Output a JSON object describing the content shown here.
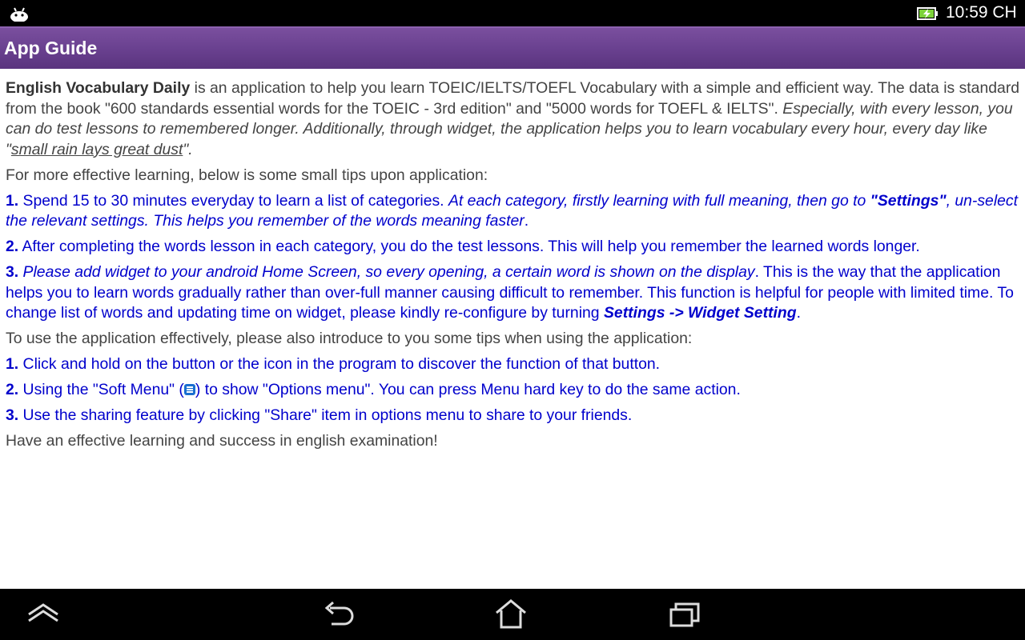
{
  "status_bar": {
    "time": "10:59 CH"
  },
  "action_bar": {
    "title": "App Guide"
  },
  "guide": {
    "intro": {
      "app_name": "English Vocabulary Daily",
      "rest": " is an application to help you learn TOEIC/IELTS/TOEFL Vocabulary with a simple and efficient way. The data is standard from the book \"600 standards essential words for the TOEIC - 3rd edition\" and \"5000 words for TOEFL & IELTS\". ",
      "italic": "Especially, with every lesson, you can do test lessons to remembered longer. Additionally, through widget, the application helps you to learn vocabulary every hour, every day like \"",
      "underlined": "small rain lays great dust",
      "italic_end": "\"."
    },
    "tips_heading": "For more effective learning, below is some small tips upon application:",
    "tip1": {
      "num": "1.",
      "text": " Spend 15 to 30 minutes everyday to learn a list of categories. ",
      "italic": "At each category, firstly learning with full meaning, then go to ",
      "bold_italic": "\"Settings\"",
      "italic2": ", un-select the relevant settings. This helps you remember of the words meaning faster",
      "end": "."
    },
    "tip2": {
      "num": "2.",
      "text": " After completing the words lesson in each category, you do the test lessons. This will help you remember the learned words longer."
    },
    "tip3": {
      "num": "3.",
      "italic": " Please add widget to your android Home Screen, so every opening, a certain word is shown on the display",
      "text": ". This is the way that the application helps you to learn words gradually rather than over-full manner causing difficult to remember. This function is helpful for people with limited time. To change list of words and updating time on widget, please kindly re-configure by turning ",
      "bold_italic": "Settings -> Widget Setting",
      "end": "."
    },
    "usage_heading": "To use the application effectively, please also introduce to you some tips when using the application:",
    "usage1": {
      "num": "1.",
      "text": " Click and hold on the button or the icon in the program to discover the function of that button."
    },
    "usage2": {
      "num": "2.",
      "text_a": " Using the \"Soft Menu\" (",
      "text_b": ") to show \"Options menu\". You can press Menu hard key to do the same action."
    },
    "usage3": {
      "num": "3.",
      "text": " Use the sharing feature by clicking \"Share\" item in options menu to share to your friends."
    },
    "closing": "Have an effective learning and success in english examination!"
  },
  "icons": {
    "status_left": "android-icon",
    "battery": "battery-charging-icon",
    "nav": [
      "collapse-up-icon",
      "back-icon",
      "home-icon",
      "recent-apps-icon"
    ]
  },
  "colors": {
    "action_bar": "#6a4190",
    "link_text": "#0000cc",
    "body_text": "#444444"
  }
}
